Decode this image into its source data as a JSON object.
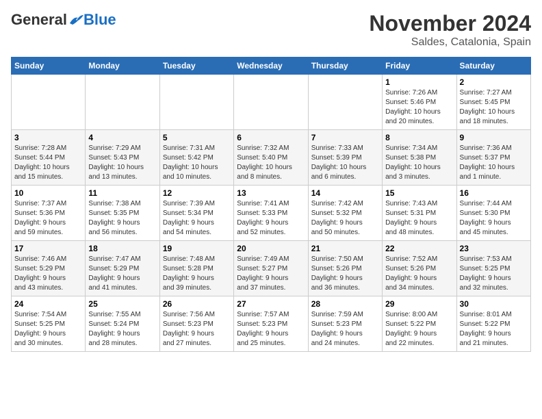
{
  "header": {
    "logo_general": "General",
    "logo_blue": "Blue",
    "month": "November 2024",
    "location": "Saldes, Catalonia, Spain"
  },
  "weekdays": [
    "Sunday",
    "Monday",
    "Tuesday",
    "Wednesday",
    "Thursday",
    "Friday",
    "Saturday"
  ],
  "weeks": [
    [
      {
        "day": "",
        "info": ""
      },
      {
        "day": "",
        "info": ""
      },
      {
        "day": "",
        "info": ""
      },
      {
        "day": "",
        "info": ""
      },
      {
        "day": "",
        "info": ""
      },
      {
        "day": "1",
        "info": "Sunrise: 7:26 AM\nSunset: 5:46 PM\nDaylight: 10 hours\nand 20 minutes."
      },
      {
        "day": "2",
        "info": "Sunrise: 7:27 AM\nSunset: 5:45 PM\nDaylight: 10 hours\nand 18 minutes."
      }
    ],
    [
      {
        "day": "3",
        "info": "Sunrise: 7:28 AM\nSunset: 5:44 PM\nDaylight: 10 hours\nand 15 minutes."
      },
      {
        "day": "4",
        "info": "Sunrise: 7:29 AM\nSunset: 5:43 PM\nDaylight: 10 hours\nand 13 minutes."
      },
      {
        "day": "5",
        "info": "Sunrise: 7:31 AM\nSunset: 5:42 PM\nDaylight: 10 hours\nand 10 minutes."
      },
      {
        "day": "6",
        "info": "Sunrise: 7:32 AM\nSunset: 5:40 PM\nDaylight: 10 hours\nand 8 minutes."
      },
      {
        "day": "7",
        "info": "Sunrise: 7:33 AM\nSunset: 5:39 PM\nDaylight: 10 hours\nand 6 minutes."
      },
      {
        "day": "8",
        "info": "Sunrise: 7:34 AM\nSunset: 5:38 PM\nDaylight: 10 hours\nand 3 minutes."
      },
      {
        "day": "9",
        "info": "Sunrise: 7:36 AM\nSunset: 5:37 PM\nDaylight: 10 hours\nand 1 minute."
      }
    ],
    [
      {
        "day": "10",
        "info": "Sunrise: 7:37 AM\nSunset: 5:36 PM\nDaylight: 9 hours\nand 59 minutes."
      },
      {
        "day": "11",
        "info": "Sunrise: 7:38 AM\nSunset: 5:35 PM\nDaylight: 9 hours\nand 56 minutes."
      },
      {
        "day": "12",
        "info": "Sunrise: 7:39 AM\nSunset: 5:34 PM\nDaylight: 9 hours\nand 54 minutes."
      },
      {
        "day": "13",
        "info": "Sunrise: 7:41 AM\nSunset: 5:33 PM\nDaylight: 9 hours\nand 52 minutes."
      },
      {
        "day": "14",
        "info": "Sunrise: 7:42 AM\nSunset: 5:32 PM\nDaylight: 9 hours\nand 50 minutes."
      },
      {
        "day": "15",
        "info": "Sunrise: 7:43 AM\nSunset: 5:31 PM\nDaylight: 9 hours\nand 48 minutes."
      },
      {
        "day": "16",
        "info": "Sunrise: 7:44 AM\nSunset: 5:30 PM\nDaylight: 9 hours\nand 45 minutes."
      }
    ],
    [
      {
        "day": "17",
        "info": "Sunrise: 7:46 AM\nSunset: 5:29 PM\nDaylight: 9 hours\nand 43 minutes."
      },
      {
        "day": "18",
        "info": "Sunrise: 7:47 AM\nSunset: 5:29 PM\nDaylight: 9 hours\nand 41 minutes."
      },
      {
        "day": "19",
        "info": "Sunrise: 7:48 AM\nSunset: 5:28 PM\nDaylight: 9 hours\nand 39 minutes."
      },
      {
        "day": "20",
        "info": "Sunrise: 7:49 AM\nSunset: 5:27 PM\nDaylight: 9 hours\nand 37 minutes."
      },
      {
        "day": "21",
        "info": "Sunrise: 7:50 AM\nSunset: 5:26 PM\nDaylight: 9 hours\nand 36 minutes."
      },
      {
        "day": "22",
        "info": "Sunrise: 7:52 AM\nSunset: 5:26 PM\nDaylight: 9 hours\nand 34 minutes."
      },
      {
        "day": "23",
        "info": "Sunrise: 7:53 AM\nSunset: 5:25 PM\nDaylight: 9 hours\nand 32 minutes."
      }
    ],
    [
      {
        "day": "24",
        "info": "Sunrise: 7:54 AM\nSunset: 5:25 PM\nDaylight: 9 hours\nand 30 minutes."
      },
      {
        "day": "25",
        "info": "Sunrise: 7:55 AM\nSunset: 5:24 PM\nDaylight: 9 hours\nand 28 minutes."
      },
      {
        "day": "26",
        "info": "Sunrise: 7:56 AM\nSunset: 5:23 PM\nDaylight: 9 hours\nand 27 minutes."
      },
      {
        "day": "27",
        "info": "Sunrise: 7:57 AM\nSunset: 5:23 PM\nDaylight: 9 hours\nand 25 minutes."
      },
      {
        "day": "28",
        "info": "Sunrise: 7:59 AM\nSunset: 5:23 PM\nDaylight: 9 hours\nand 24 minutes."
      },
      {
        "day": "29",
        "info": "Sunrise: 8:00 AM\nSunset: 5:22 PM\nDaylight: 9 hours\nand 22 minutes."
      },
      {
        "day": "30",
        "info": "Sunrise: 8:01 AM\nSunset: 5:22 PM\nDaylight: 9 hours\nand 21 minutes."
      }
    ]
  ]
}
